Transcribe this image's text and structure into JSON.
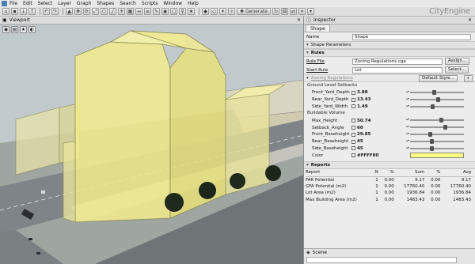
{
  "menu": [
    "File",
    "Edit",
    "Select",
    "Layer",
    "Graph",
    "Shapes",
    "Search",
    "Scripts",
    "Window",
    "Help"
  ],
  "toolbar": {
    "generate_label": "Generate"
  },
  "brand": "CityEngine",
  "viewport": {
    "title": "Viewport"
  },
  "inspector": {
    "title": "Inspector",
    "tab": "Shape",
    "name_label": "Name",
    "name_value": "Shape",
    "shape_params": "Shape Parameters",
    "rules_label": "Rules",
    "rule_file_label": "Rule File",
    "rule_file_value": "Zoning Regulations.cga",
    "assign_label": "Assign...",
    "start_rule_label": "Start Rule",
    "start_rule_value": "Lot",
    "select_label": "Select...",
    "zoning_label": "Zoning Regulations",
    "default_style_label": "Default Style...",
    "setbacks_group": "Ground Level Setbacks",
    "volume_group": "Buildable Volume",
    "params": [
      {
        "name": "Front_Yard_Depth",
        "value": "3.88",
        "pos": 0.44
      },
      {
        "name": "Rear_Yard_Depth",
        "value": "13.43",
        "pos": 0.52
      },
      {
        "name": "Side_Yard_Width",
        "value": "1.49",
        "pos": 0.42
      },
      {
        "name": "Max_Height",
        "value": "50.74",
        "pos": 0.58
      },
      {
        "name": "Setback_Angle",
        "value": "60",
        "pos": 0.66
      },
      {
        "name": "Front_Baseheight",
        "value": "29.85",
        "pos": 0.36
      },
      {
        "name": "Rear_Baseheight",
        "value": "45",
        "pos": 0.4
      },
      {
        "name": "Side_Baseheight",
        "value": "45",
        "pos": 0.4
      }
    ],
    "color_label": "Color",
    "color_value": "#FFFF80",
    "reports_label": "Reports",
    "report_headers": [
      "Report",
      "N",
      "%",
      "Sum",
      "%",
      "Avg"
    ],
    "report_rows": [
      [
        "FAR Potential",
        "1",
        "0.00",
        "9.17",
        "0.00",
        "9.17"
      ],
      [
        "GFA Potential (m2)",
        "1",
        "0.00",
        "17760.40",
        "0.00",
        "17760.40"
      ],
      [
        "Lot Area (m2)",
        "1",
        "0.00",
        "1936.84",
        "0.00",
        "1936.84"
      ],
      [
        "Max Building Area (m2)",
        "1",
        "0.00",
        "1483.43",
        "0.00",
        "1483.43"
      ]
    ]
  },
  "scene": {
    "title": "Scene"
  },
  "colors": {
    "volume": "#f2ec8c",
    "volume_edge": "#8a8a55",
    "street": "#7f8488",
    "swatch": "#FFFF80"
  }
}
